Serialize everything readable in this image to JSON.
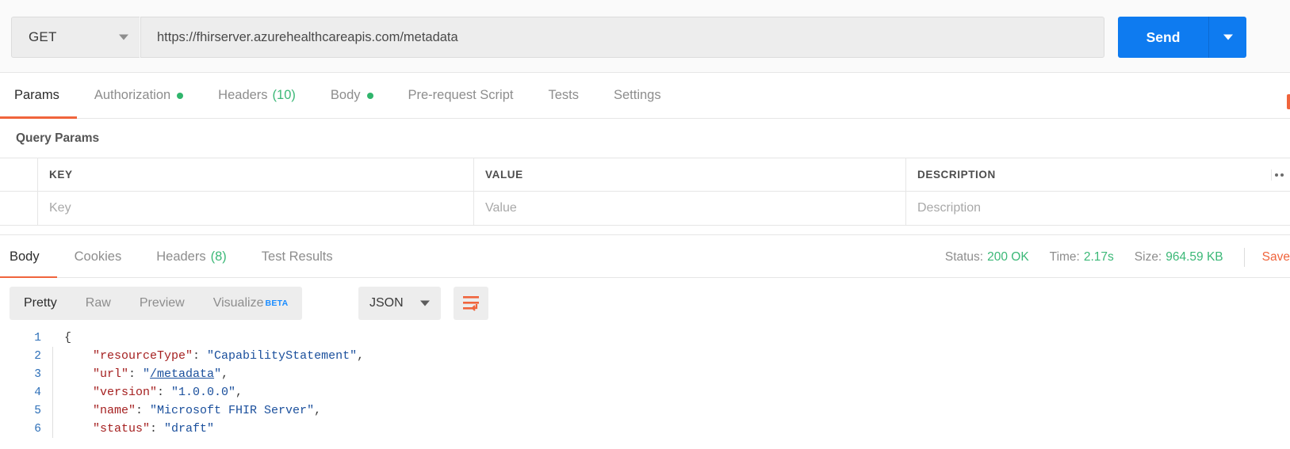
{
  "request": {
    "method": "GET",
    "url": "https://fhirserver.azurehealthcareapis.com/metadata",
    "send_label": "Send",
    "tabs": [
      {
        "label": "Params",
        "active": true,
        "dot": false,
        "count": ""
      },
      {
        "label": "Authorization",
        "active": false,
        "dot": true,
        "count": ""
      },
      {
        "label": "Headers",
        "active": false,
        "dot": false,
        "count": "(10)"
      },
      {
        "label": "Body",
        "active": false,
        "dot": true,
        "count": ""
      },
      {
        "label": "Pre-request Script",
        "active": false,
        "dot": false,
        "count": ""
      },
      {
        "label": "Tests",
        "active": false,
        "dot": false,
        "count": ""
      },
      {
        "label": "Settings",
        "active": false,
        "dot": false,
        "count": ""
      }
    ]
  },
  "query_params": {
    "section_title": "Query Params",
    "columns": [
      "KEY",
      "VALUE",
      "DESCRIPTION"
    ],
    "rows": [
      {
        "key": "Key",
        "value": "Value",
        "description": "Description"
      }
    ],
    "bulk_edit_icon": "ellipsis-icon"
  },
  "response": {
    "tabs": [
      {
        "label": "Body",
        "active": true,
        "count": ""
      },
      {
        "label": "Cookies",
        "active": false,
        "count": ""
      },
      {
        "label": "Headers",
        "active": false,
        "count": "(8)"
      },
      {
        "label": "Test Results",
        "active": false,
        "count": ""
      }
    ],
    "status_label": "Status:",
    "status_value": "200 OK",
    "time_label": "Time:",
    "time_value": "2.17s",
    "size_label": "Size:",
    "size_value": "964.59 KB",
    "save_label": "Save",
    "view_modes": [
      {
        "label": "Pretty",
        "active": true,
        "beta": ""
      },
      {
        "label": "Raw",
        "active": false,
        "beta": ""
      },
      {
        "label": "Preview",
        "active": false,
        "beta": ""
      },
      {
        "label": "Visualize",
        "active": false,
        "beta": "BETA"
      }
    ],
    "format": "JSON",
    "wrap_icon": "word-wrap-icon"
  },
  "body_json": {
    "lines": [
      {
        "n": "1",
        "indent": 0,
        "tokens": [
          {
            "t": "punc",
            "s": "{"
          }
        ]
      },
      {
        "n": "2",
        "indent": 1,
        "tokens": [
          {
            "t": "key",
            "s": "\"resourceType\""
          },
          {
            "t": "punc",
            "s": ": "
          },
          {
            "t": "str",
            "s": "\"CapabilityStatement\""
          },
          {
            "t": "punc",
            "s": ","
          }
        ]
      },
      {
        "n": "3",
        "indent": 1,
        "tokens": [
          {
            "t": "key",
            "s": "\"url\""
          },
          {
            "t": "punc",
            "s": ": "
          },
          {
            "t": "str",
            "s": "\""
          },
          {
            "t": "link",
            "s": "/metadata"
          },
          {
            "t": "str",
            "s": "\""
          },
          {
            "t": "punc",
            "s": ","
          }
        ]
      },
      {
        "n": "4",
        "indent": 1,
        "tokens": [
          {
            "t": "key",
            "s": "\"version\""
          },
          {
            "t": "punc",
            "s": ": "
          },
          {
            "t": "str",
            "s": "\"1.0.0.0\""
          },
          {
            "t": "punc",
            "s": ","
          }
        ]
      },
      {
        "n": "5",
        "indent": 1,
        "tokens": [
          {
            "t": "key",
            "s": "\"name\""
          },
          {
            "t": "punc",
            "s": ": "
          },
          {
            "t": "str",
            "s": "\"Microsoft FHIR Server\""
          },
          {
            "t": "punc",
            "s": ","
          }
        ]
      },
      {
        "n": "6",
        "indent": 1,
        "tokens": [
          {
            "t": "key",
            "s": "\"status\""
          },
          {
            "t": "punc",
            "s": ": "
          },
          {
            "t": "str",
            "s": "\"draft\""
          }
        ]
      }
    ]
  },
  "colors": {
    "accent_orange": "#f0643c",
    "send_blue": "#0e7bf0",
    "success_green": "#3bb877",
    "json_key": "#a52020",
    "json_string": "#1a4f9c",
    "line_number": "#2d6fb8"
  }
}
